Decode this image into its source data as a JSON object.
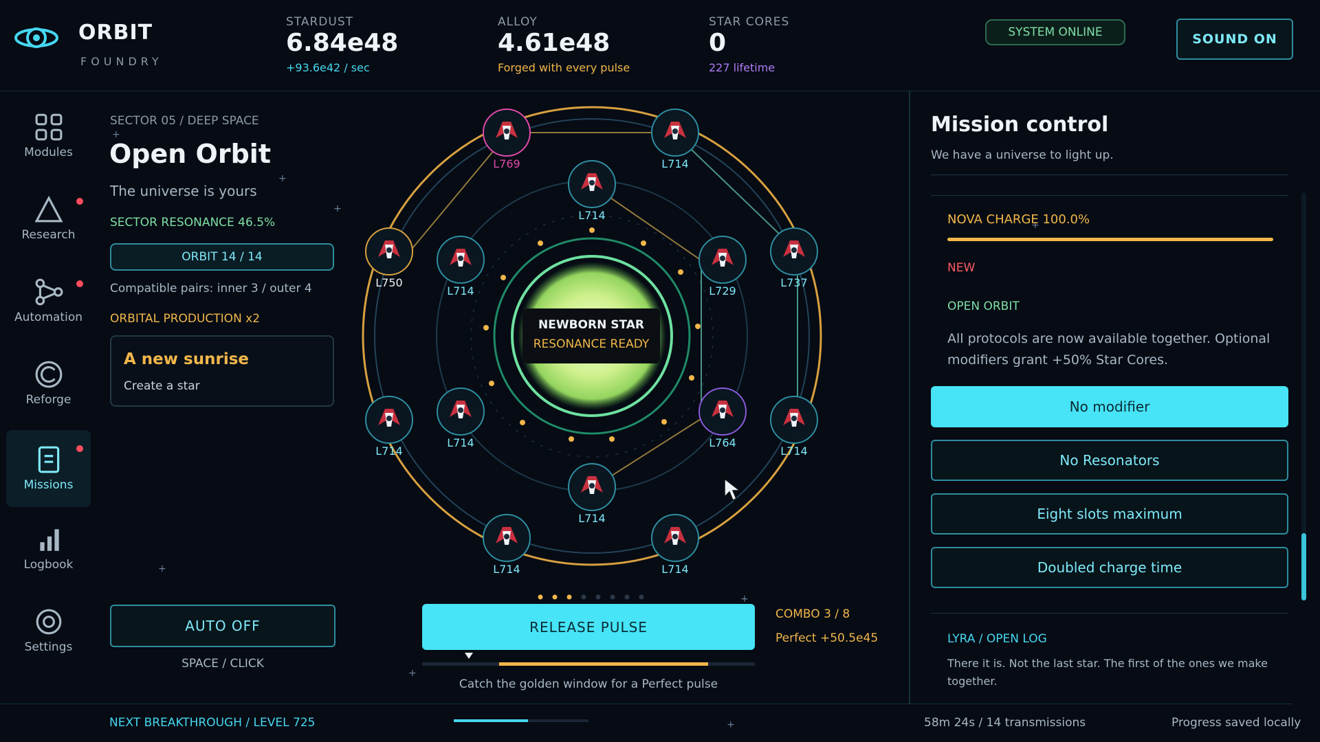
{
  "brand": {
    "title": "ORBIT",
    "subtitle": "FOUNDRY"
  },
  "resources": [
    {
      "label": "STARDUST",
      "value": "6.84e48",
      "sub": "+93.6e42 / sec",
      "sub_color": "#46d7f0"
    },
    {
      "label": "ALLOY",
      "value": "4.61e48",
      "sub": "Forged with every pulse",
      "sub_color": "#f2b74a"
    },
    {
      "label": "STAR CORES",
      "value": "0",
      "sub": "227 lifetime",
      "sub_color": "#b07cf6"
    }
  ],
  "status": {
    "online": "SYSTEM ONLINE",
    "sound": "SOUND ON"
  },
  "nav": [
    {
      "label": "Modules",
      "icon": "modules-icon",
      "alert": false
    },
    {
      "label": "Research",
      "icon": "research-icon",
      "alert": true
    },
    {
      "label": "Automation",
      "icon": "automation-icon",
      "alert": true
    },
    {
      "label": "Reforge",
      "icon": "reforge-icon",
      "alert": false
    },
    {
      "label": "Missions",
      "icon": "missions-icon",
      "alert": true,
      "active": true
    },
    {
      "label": "Logbook",
      "icon": "logbook-icon",
      "alert": false
    },
    {
      "label": "Settings",
      "icon": "settings-icon",
      "alert": false
    }
  ],
  "sector": {
    "breadcrumb": "SECTOR 05 / DEEP SPACE",
    "title": "Open Orbit",
    "tagline": "The universe is yours",
    "resonance": "SECTOR RESONANCE 46.5%",
    "orbit_button": "ORBIT 14 / 14",
    "pairs": "Compatible pairs: inner 3 / outer 4",
    "production": "ORBITAL PRODUCTION x2",
    "goal_title": "A new sunrise",
    "goal_desc": "Create a star",
    "auto": "AUTO OFF",
    "hint": "SPACE / CLICK"
  },
  "star": {
    "title": "NEWBORN STAR",
    "status": "RESONANCE READY"
  },
  "ships": [
    {
      "label": "L769",
      "color": "#e04aa8"
    },
    {
      "label": "L714",
      "color": "#7ee9f8"
    },
    {
      "label": "L714",
      "color": "#7ee9f8"
    },
    {
      "label": "L750",
      "color": "#eef3f7"
    },
    {
      "label": "L714",
      "color": "#7ee9f8"
    },
    {
      "label": "L729",
      "color": "#7ee9f8"
    },
    {
      "label": "L737",
      "color": "#7ee9f8"
    },
    {
      "label": "L714",
      "color": "#7ee9f8"
    },
    {
      "label": "L714",
      "color": "#7ee9f8"
    },
    {
      "label": "L764",
      "color": "#7ee9f8"
    },
    {
      "label": "L714",
      "color": "#7ee9f8"
    },
    {
      "label": "L714",
      "color": "#7ee9f8"
    },
    {
      "label": "L714",
      "color": "#7ee9f8"
    },
    {
      "label": "L714",
      "color": "#7ee9f8"
    }
  ],
  "pulse": {
    "button": "RELEASE PULSE",
    "combo": "COMBO 3 / 8",
    "perfect": "Perfect +50.5e45",
    "caption": "Catch the golden window for a Perfect pulse",
    "combo_current": 3,
    "combo_max": 8
  },
  "mission": {
    "title": "Mission control",
    "subtitle": "We have a universe to light up.",
    "nova": "NOVA CHARGE 100.0%",
    "nova_progress": 1.0,
    "new_tag": "NEW",
    "protocol": "OPEN ORBIT",
    "description": "All protocols are now available together. Optional modifiers grant +50% Star Cores.",
    "options": [
      "No modifier",
      "No Resonators",
      "Eight slots maximum",
      "Doubled charge time"
    ],
    "log_title": "LYRA / OPEN LOG",
    "log_text": "There it is. Not the last star. The first of the ones we make together."
  },
  "footer": {
    "breakthrough": "NEXT BREAKTHROUGH / LEVEL 725",
    "transmissions": "58m 24s / 14 transmissions",
    "saved": "Progress saved locally",
    "breakthrough_progress": 0.55
  }
}
